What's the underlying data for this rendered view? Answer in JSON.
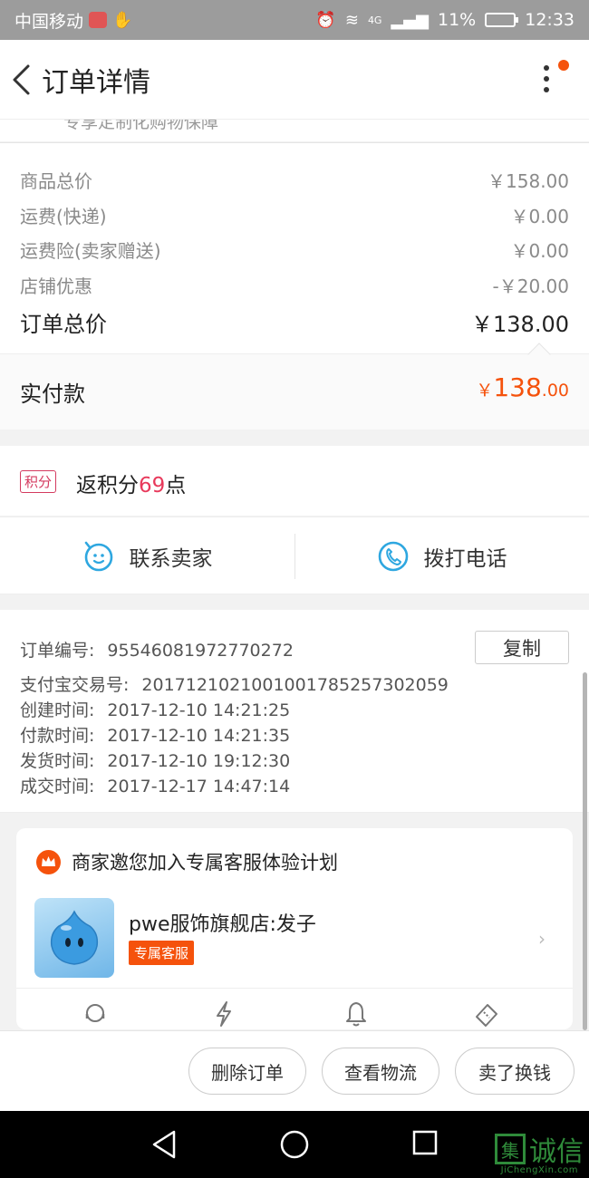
{
  "status_bar": {
    "carrier": "中国移动",
    "signal": "4G",
    "battery": "11%",
    "time": "12:33"
  },
  "header": {
    "title": "订单详情"
  },
  "peek_text": "专享定制化购物保障",
  "price": {
    "rows": [
      {
        "label": "商品总价",
        "value": "￥158.00"
      },
      {
        "label": "运费(快递)",
        "value": "￥0.00"
      },
      {
        "label": "运费险(卖家赠送)",
        "value": "￥0.00"
      },
      {
        "label": "店铺优惠",
        "value": "-￥20.00"
      }
    ],
    "total_label": "订单总价",
    "total_value": "￥138.00"
  },
  "paid": {
    "label": "实付款",
    "currency": "￥",
    "integer": "138",
    "decimal": ".00"
  },
  "points": {
    "badge": "积分",
    "prefix": "返积分",
    "number": "69",
    "suffix": "点"
  },
  "contact": {
    "seller_label": "联系卖家",
    "phone_label": "拨打电话"
  },
  "order_info": {
    "copy_label": "复制",
    "rows": [
      {
        "label": "订单编号:",
        "value": "95546081972770272"
      },
      {
        "label": "支付宝交易号:",
        "value": "2017121021001001785257302059"
      },
      {
        "label": "创建时间:",
        "value": "2017-12-10 14:21:25"
      },
      {
        "label": "付款时间:",
        "value": "2017-12-10 14:21:35"
      },
      {
        "label": "发货时间:",
        "value": "2017-12-10 19:12:30"
      },
      {
        "label": "成交时间:",
        "value": "2017-12-17 14:47:14"
      }
    ]
  },
  "service": {
    "title": "商家邀您加入专属客服体验计划",
    "shop_name": "pwe服饰旗舰店:发子",
    "tag": "专属客服"
  },
  "actions": {
    "delete": "删除订单",
    "logistics": "查看物流",
    "resell": "卖了换钱"
  },
  "watermark": {
    "box": "集",
    "text": "诚信",
    "sub": "JiChengXin.com"
  },
  "colors": {
    "accent": "#f5520c",
    "points": "#e8395b",
    "icon_blue": "#2ea7e0"
  }
}
